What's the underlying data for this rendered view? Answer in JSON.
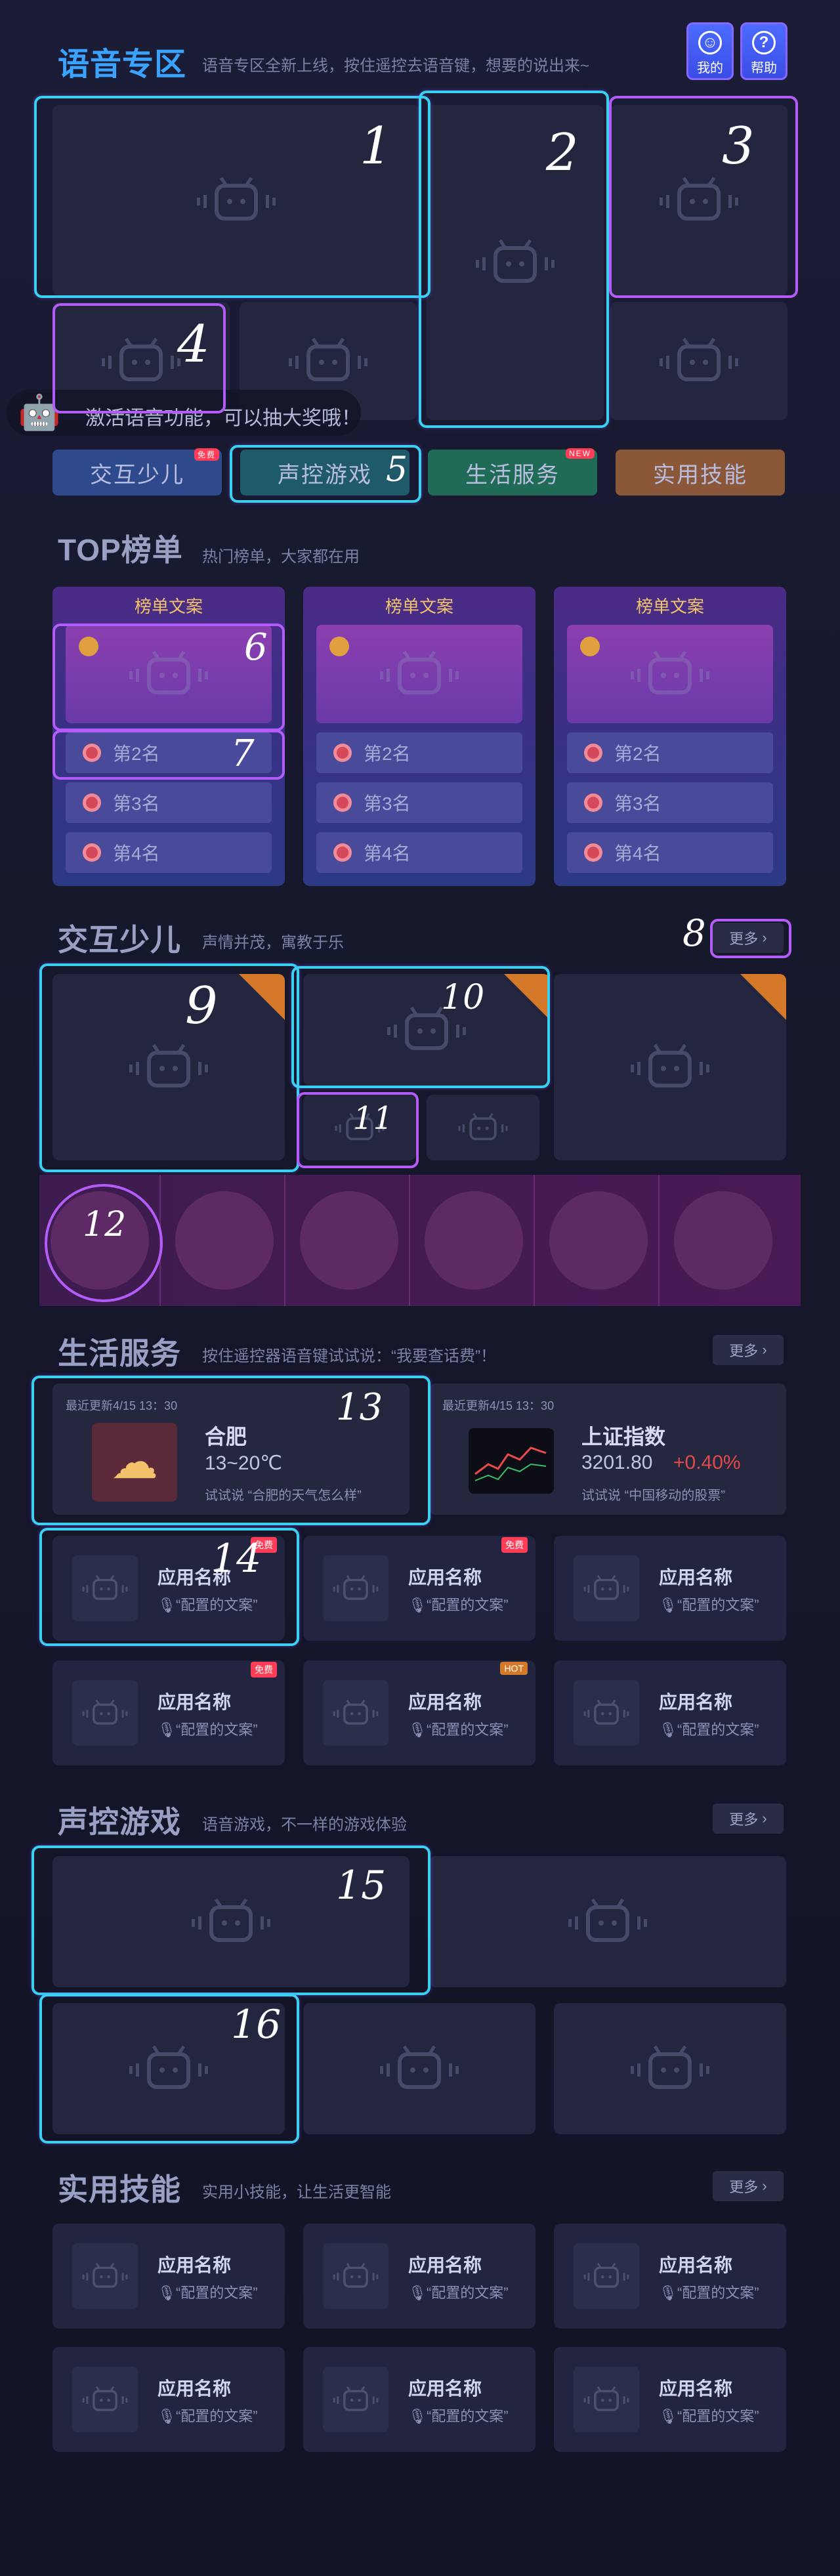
{
  "header": {
    "title": "语音专区",
    "subtitle": "语音专区全新上线，按住遥控去语音键，想要的说出来~",
    "mine_label": "我的",
    "help_label": "帮助"
  },
  "banner": {
    "activate_text": "激活语音功能，可以抽大奖哦！"
  },
  "tabs": [
    {
      "label": "交互少儿",
      "tag": "免费",
      "color": "#2f4a8c"
    },
    {
      "label": "声控游戏",
      "tag": "",
      "color": "#1e5a6a"
    },
    {
      "label": "生活服务",
      "tag": "NEW",
      "color": "#1f6b55"
    },
    {
      "label": "实用技能",
      "tag": "",
      "color": "#8a5838"
    }
  ],
  "top": {
    "title": "TOP榜单",
    "subtitle": "热门榜单，大家都在用",
    "panels": [
      {
        "head": "榜单文案",
        "rows": [
          "第2名",
          "第3名",
          "第4名"
        ]
      },
      {
        "head": "榜单文案",
        "rows": [
          "第2名",
          "第3名",
          "第4名"
        ]
      },
      {
        "head": "榜单文案",
        "rows": [
          "第2名",
          "第3名",
          "第4名"
        ]
      }
    ]
  },
  "kids": {
    "title": "交互少儿",
    "subtitle": "声情并茂，寓教于乐",
    "more": "更多"
  },
  "life": {
    "title": "生活服务",
    "subtitle": "按住遥控器语音键试试说：“我要查话费”！",
    "more": "更多",
    "weather": {
      "updated": "最近更新4/15 13：30",
      "city": "合肥",
      "temp": "13~20℃",
      "hint": "试试说 “合肥的天气怎么样”"
    },
    "stock": {
      "updated": "最近更新4/15 13：30",
      "name": "上证指数",
      "value": "3201.80",
      "change": "+0.40%",
      "hint": "试试说 “中国移动的股票”"
    },
    "apps": [
      {
        "name": "应用名称",
        "hint": "“配置的文案”",
        "tag": "免费"
      },
      {
        "name": "应用名称",
        "hint": "“配置的文案”",
        "tag": "免费"
      },
      {
        "name": "应用名称",
        "hint": "“配置的文案”",
        "tag": ""
      },
      {
        "name": "应用名称",
        "hint": "“配置的文案”",
        "tag": "免费"
      },
      {
        "name": "应用名称",
        "hint": "“配置的文案”",
        "tag": "HOT"
      },
      {
        "name": "应用名称",
        "hint": "“配置的文案”",
        "tag": ""
      }
    ]
  },
  "games": {
    "title": "声控游戏",
    "subtitle": "语音游戏，不一样的游戏体验",
    "more": "更多"
  },
  "skills": {
    "title": "实用技能",
    "subtitle": "实用小技能，让生活更智能",
    "more": "更多",
    "apps": [
      {
        "name": "应用名称",
        "hint": "“配置的文案”"
      },
      {
        "name": "应用名称",
        "hint": "“配置的文案”"
      },
      {
        "name": "应用名称",
        "hint": "“配置的文案”"
      },
      {
        "name": "应用名称",
        "hint": "“配置的文案”"
      },
      {
        "name": "应用名称",
        "hint": "“配置的文案”"
      },
      {
        "name": "应用名称",
        "hint": "“配置的文案”"
      }
    ]
  },
  "annotations": [
    "1",
    "2",
    "3",
    "4",
    "5",
    "6",
    "7",
    "8",
    "9",
    "10",
    "11",
    "12",
    "13",
    "14",
    "15",
    "16"
  ]
}
